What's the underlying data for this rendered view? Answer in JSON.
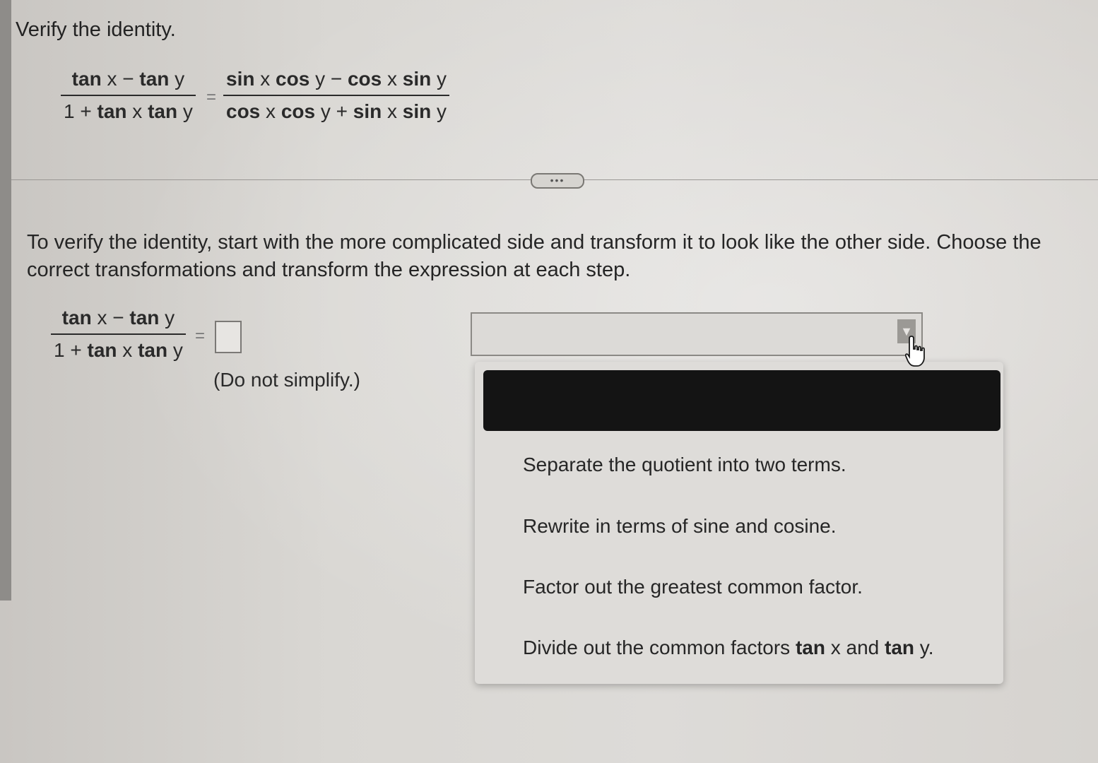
{
  "prompt": "Verify the identity.",
  "identity": {
    "lhs": {
      "numerator": [
        "tan",
        "x",
        "−",
        "tan",
        "y"
      ],
      "denominator": [
        "1",
        "+",
        "tan",
        "x",
        "tan",
        "y"
      ]
    },
    "equals": "=",
    "rhs": {
      "numerator": [
        "sin",
        "x",
        "cos",
        "y",
        "−",
        "cos",
        "x",
        "sin",
        "y"
      ],
      "denominator": [
        "cos",
        "x",
        "cos",
        "y",
        "+",
        "sin",
        "x",
        "sin",
        "y"
      ]
    }
  },
  "more_button": "•••",
  "instructions": "To verify the identity, start with the more complicated side and transform it to look like the other side. Choose the correct transformations and transform the expression at each step.",
  "step": {
    "numerator": [
      "tan",
      "x",
      "−",
      "tan",
      "y"
    ],
    "denominator": [
      "1",
      "+",
      "tan",
      "x",
      "tan",
      "y"
    ],
    "equals": "=",
    "answer_value": "",
    "note": "(Do not simplify.)"
  },
  "dropdown": {
    "selected_value": "",
    "arrow_icon": "triangle-down-icon",
    "options": [
      {
        "label": "Separate the quotient into two terms."
      },
      {
        "label": "Rewrite in terms of sine and cosine."
      },
      {
        "label": "Factor out the greatest common factor."
      },
      {
        "prefix": "Divide out the common factors ",
        "b1": "tan",
        "mid1": " x and ",
        "b2": "tan",
        "suffix": " y."
      }
    ]
  }
}
